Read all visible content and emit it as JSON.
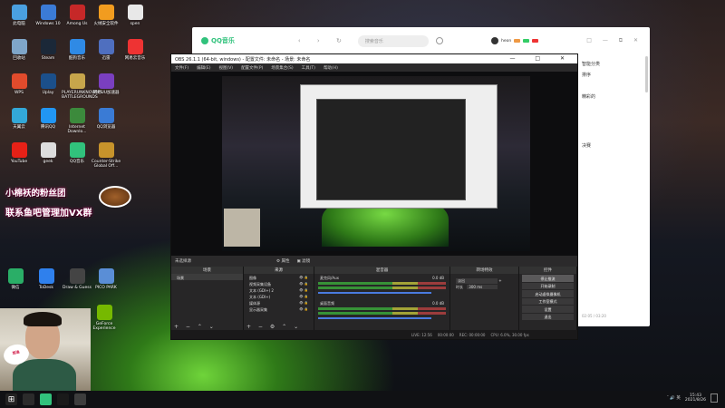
{
  "desktop_icons": [
    {
      "label": "此电脑",
      "color": "#4aa0e0",
      "icon": "computer-icon"
    },
    {
      "label": "Windows 10",
      "color": "#3b7bd6",
      "icon": "windows-icon"
    },
    {
      "label": "Among Us",
      "color": "#c62828",
      "icon": "among-us-icon"
    },
    {
      "label": "火绒安全软件",
      "color": "#f29c1f",
      "icon": "huorong-icon"
    },
    {
      "label": "spen",
      "color": "#e8e8e8",
      "icon": "file-icon"
    },
    {
      "label": "回收站",
      "color": "#7fa6c9",
      "icon": "recycle-bin-icon"
    },
    {
      "label": "Steam",
      "color": "#1b2838",
      "icon": "steam-icon"
    },
    {
      "label": "酷狗音乐",
      "color": "#2f8ae5",
      "icon": "kugou-icon"
    },
    {
      "label": "迅雷",
      "color": "#4f6fbf",
      "icon": "xunlei-icon"
    },
    {
      "label": "网易云音乐",
      "color": "#e33",
      "icon": "netease-icon"
    },
    {
      "label": "WPS",
      "color": "#e14b2c",
      "icon": "wps-icon"
    },
    {
      "label": "Uplay",
      "color": "#1b4f8a",
      "icon": "uplay-icon"
    },
    {
      "label": "PLAYERUNKNOWN'S BATTLEGROUNDS",
      "color": "#c7a54b",
      "icon": "pubg-icon"
    },
    {
      "label": "网易UU加速器",
      "color": "#7a3fbf",
      "icon": "uu-icon"
    },
    {
      "label": "天翼云",
      "color": "#33a8d8",
      "icon": "cloud-icon"
    },
    {
      "label": "腾讯QQ",
      "color": "#2196f3",
      "icon": "qq-icon"
    },
    {
      "label": "Internet Downlo...",
      "color": "#3c8a3c",
      "icon": "idm-icon"
    },
    {
      "label": "QQ浏览器",
      "color": "#3a7bd5",
      "icon": "qq-browser-icon"
    },
    {
      "label": "YouTube",
      "color": "#e62117",
      "icon": "youtube-icon"
    },
    {
      "label": "geek",
      "color": "#ddd",
      "icon": "geek-icon"
    },
    {
      "label": "QQ音乐",
      "color": "#31c27c",
      "icon": "qq-music-icon"
    },
    {
      "label": "Counter-Strike Global Off...",
      "color": "#c7932b",
      "icon": "csgo-icon"
    },
    {
      "label": "微信",
      "color": "#2aae67",
      "icon": "wechat-icon"
    },
    {
      "label": "ToDesk",
      "color": "#2f80ed",
      "icon": "todesk-icon"
    },
    {
      "label": "Draw & Guess",
      "color": "#444",
      "icon": "draw-guess-icon"
    },
    {
      "label": "PICO PARK",
      "color": "#5a8ed6",
      "icon": "pico-park-icon"
    },
    {
      "label": "GeForce Experience",
      "color": "#76b900",
      "icon": "geforce-icon"
    }
  ],
  "promo": {
    "line1": "小棉袄的粉丝团",
    "line2": "联系鱼吧管理加VX群"
  },
  "webcam": {
    "sticker": "加油"
  },
  "qq_music": {
    "brand": "QQ音乐",
    "nav": "‹ › ↻",
    "search_placeholder": "搜索音乐",
    "username": "heon",
    "window_controls": "□ — ⧉ ✕",
    "side_lines": [
      "智能分类",
      "",
      "排序",
      "",
      "",
      "",
      "精彩的",
      "",
      "",
      "",
      "",
      "",
      "",
      "",
      "",
      "决赛"
    ],
    "time": "02:05 / 03:20"
  },
  "obs": {
    "title": "OBS 26.1.1 (64-bit, windows) - 配置文件: 未命名 - 场景: 未命名",
    "window_controls": "— □ ✕",
    "menu": [
      "文件(F)",
      "编辑(E)",
      "视图(V)",
      "配置文件(P)",
      "场景集合(S)",
      "工具(T)",
      "帮助(H)"
    ],
    "no_source": "未选择源",
    "properties_btn": "属性",
    "filters_btn": "滤镜",
    "scenes_header": "场景",
    "scenes": [
      "场景"
    ],
    "sources_header": "来源",
    "sources": [
      "图像",
      "视频采集设备",
      "文本 (GDI+) 2",
      "文本 (GDI+)",
      "媒体源",
      "显示器采集"
    ],
    "mixer_header": "混音器",
    "mixer": [
      {
        "name": "麦克风/Aux",
        "db": "0.0 dB"
      },
      {
        "name": "桌面音频",
        "db": "0.0 dB"
      }
    ],
    "transitions_header": "转场特效",
    "transition": "淡出",
    "duration_label": "时长",
    "duration": "300 ms",
    "controls_header": "控件",
    "controls": [
      "停止推流",
      "开始录制",
      "启动虚拟摄像机",
      "工作室模式",
      "设置",
      "退出"
    ],
    "status": [
      "LIVE: 12:56",
      "00:00:00",
      "REC: 00:00:00",
      "CPU: 6.0%, 30.00 fps"
    ]
  },
  "taskbar": {
    "time": "15:43",
    "date": "2021/8/26",
    "apps": [
      "#2b2b2b",
      "#31c27c",
      "#1a1a1a",
      "#3d3d3d"
    ],
    "tray": "ˆ 🔊 英"
  }
}
